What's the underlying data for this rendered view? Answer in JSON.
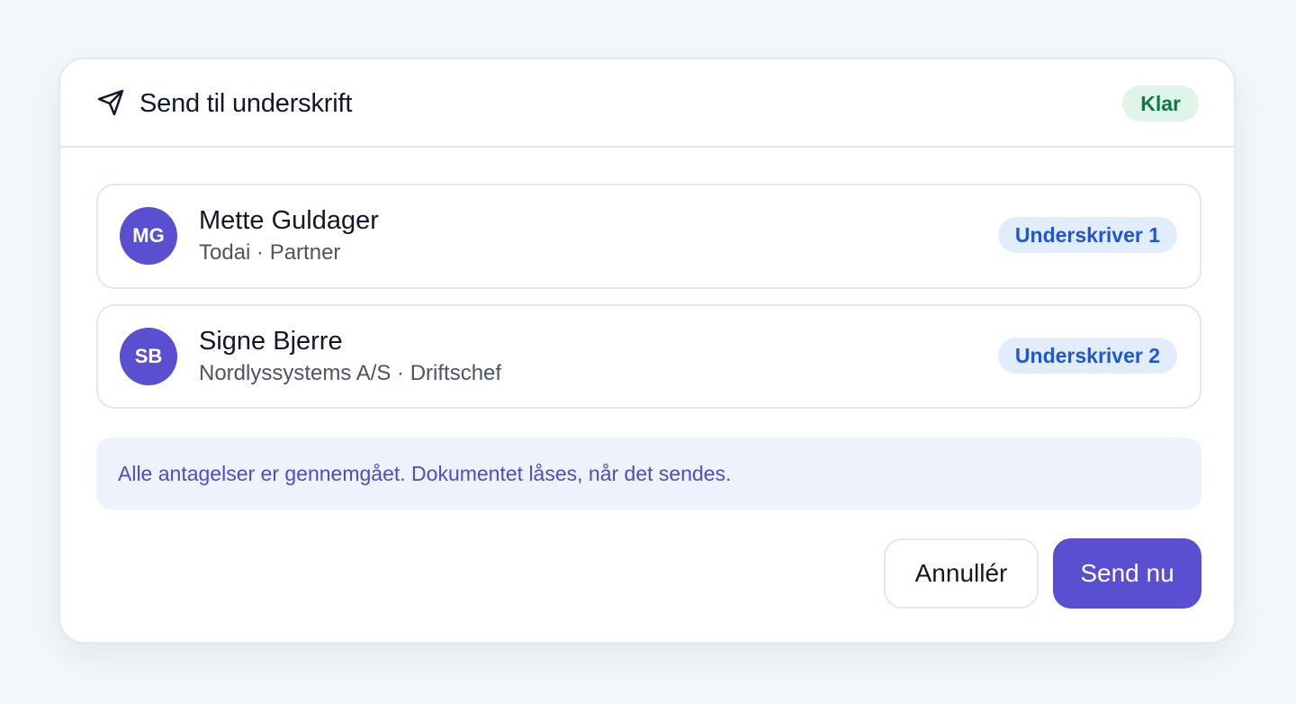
{
  "dialog": {
    "title": "Send til underskrift",
    "icon": "paper-plane-icon",
    "status": "Klar",
    "colors": {
      "accent": "#5b4fd1",
      "status_background": "#dff5ea",
      "status_text": "#0d7a45",
      "role_background": "#e2edfc",
      "role_text": "#1f55d6",
      "note_background": "#eef2fc",
      "note_text": "#5648c7"
    }
  },
  "signers": [
    {
      "initials": "MG",
      "name": "Mette Guldager",
      "meta": "Todai · Partner",
      "role": "Underskriver 1"
    },
    {
      "initials": "SB",
      "name": "Signe Bjerre",
      "meta": "Nordlyssystems A/S · Driftschef",
      "role": "Underskriver 2"
    }
  ],
  "note": "Alle antagelser er gennemgået. Dokumentet låses, når det sendes.",
  "actions": {
    "cancel": "Annullér",
    "send": "Send nu"
  }
}
